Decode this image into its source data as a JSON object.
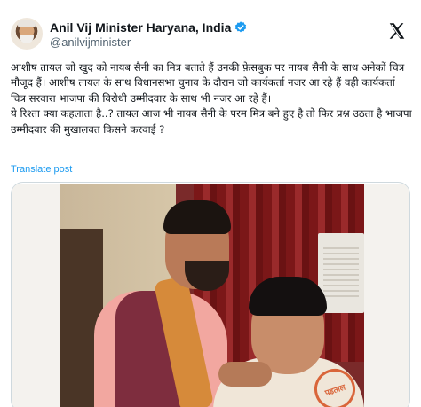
{
  "author": {
    "name": "Anil Vij Minister Haryana, India",
    "handle": "@anilvijminister",
    "verified": true,
    "avatar_icon": "avatar-photo"
  },
  "top_fragment": "",
  "icons": {
    "verified": "verified-badge-icon",
    "x": "x-logo-icon"
  },
  "colors": {
    "accent": "#1d9bf0",
    "text": "#0f1419",
    "muted": "#536471"
  },
  "tweet": {
    "paragraph1": "आशीष तायल जो खुद को नायब सैनी का मित्र बताते हैं उनकी फ़ेसबुक पर नायब सैनी के साथ अनेकों चित्र मौजूद हैं। आशीष तायल के साथ विधानसभा चुनाव के दौरान जो कार्यकर्ता नजर आ रहे हैं वही कार्यकर्ता चित्र सरवारा भाजपा की विरोधी उम्मीदवार के साथ भी नजर आ रहे हैं।",
    "paragraph2": "ये रिश्ता क्या कहलाता है..? तायल आज भी नायब सैनी के परम मित्र बने हुए है तो फिर प्रश्न उठता है भाजपा उम्मीदवार की मुखालवत किसने करवाई ?"
  },
  "translate_label": "Translate post",
  "media": {
    "stamp_text": "पड़ताल"
  }
}
